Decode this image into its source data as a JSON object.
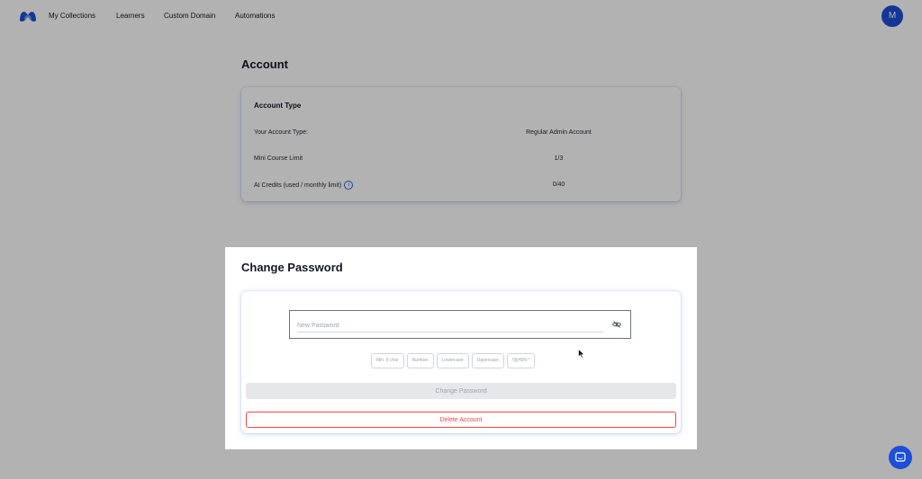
{
  "nav": {
    "logo_icon": "app-logo",
    "links": [
      "My Collections",
      "Learners",
      "Custom Domain",
      "Automations"
    ],
    "avatar_initial": "M"
  },
  "account": {
    "heading": "Account",
    "card_title": "Account Type",
    "rows": [
      {
        "label": "Your Account Type:",
        "value": "Regular Admin Account"
      },
      {
        "label": "Mini Course Limit",
        "value": "1/3"
      },
      {
        "label": "AI Credits (used / monthly limit)",
        "value": "0/40",
        "info_icon": "info-icon"
      }
    ]
  },
  "modal": {
    "title": "Change Password",
    "password_placeholder": "New Password",
    "password_value": "",
    "eye_icon": "eye-slash-icon",
    "requirements": [
      "Min. 8 char",
      "Number",
      "Lowercase",
      "Uppercase",
      "!@#$%^"
    ],
    "change_button": "Change Password",
    "delete_button": "Delete Account"
  },
  "colors": {
    "accent": "#1d4fd8",
    "danger": "#ef4444",
    "overlay": "rgba(0,0,0,0.30)"
  },
  "chat_icon": "chat-icon"
}
